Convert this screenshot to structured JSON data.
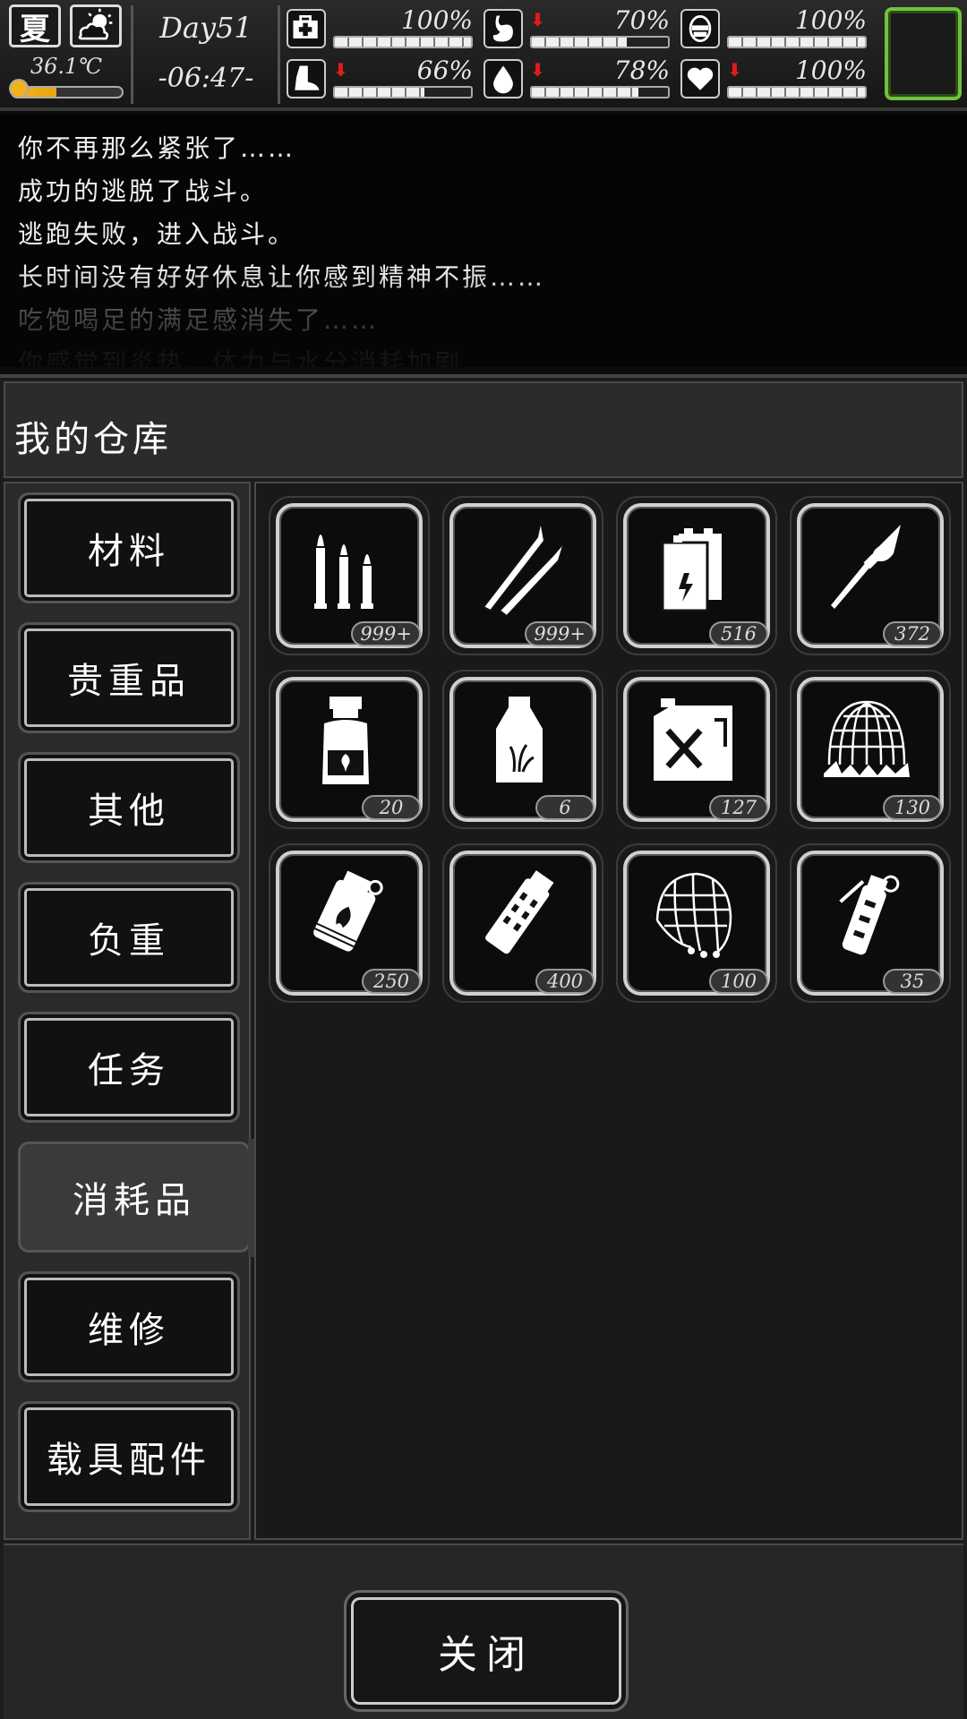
{
  "hud": {
    "season": "夏",
    "weather_icon": "sun-cloud-icon",
    "temperature": "36.1℃",
    "temperature_level": 0.4,
    "day": "Day51",
    "time": "-06:47-",
    "stats": [
      {
        "id": "health",
        "icon": "medkit-icon",
        "value": "100%",
        "level": 1.0,
        "arrow": ""
      },
      {
        "id": "hunger",
        "icon": "stomach-icon",
        "value": "70%",
        "level": 0.7,
        "arrow": "down"
      },
      {
        "id": "armor",
        "icon": "shield-icon",
        "value": "100%",
        "level": 1.0,
        "arrow": ""
      },
      {
        "id": "stamina",
        "icon": "boot-icon",
        "value": "66%",
        "level": 0.66,
        "arrow": "down"
      },
      {
        "id": "thirst",
        "icon": "water-drop-icon",
        "value": "78%",
        "level": 0.78,
        "arrow": "down"
      },
      {
        "id": "mood",
        "icon": "heart-icon",
        "value": "100%",
        "level": 1.0,
        "arrow": "down"
      }
    ],
    "down_arrow": "⬇"
  },
  "log": {
    "lines": [
      "你不再那么紧张了……",
      "成功的逃脱了战斗。",
      "逃跑失败，进入战斗。",
      "长时间没有好好休息让你感到精神不振……",
      "吃饱喝足的满足感消失了……",
      "你感觉到炎热，体力与水分消耗加剧"
    ]
  },
  "warehouse": {
    "title": "我的仓库",
    "tabs": [
      {
        "label": "材料",
        "active": false
      },
      {
        "label": "贵重品",
        "active": false
      },
      {
        "label": "其他",
        "active": false
      },
      {
        "label": "负重",
        "active": false
      },
      {
        "label": "任务",
        "active": false
      },
      {
        "label": "消耗品",
        "active": true
      },
      {
        "label": "维修",
        "active": false
      },
      {
        "label": "载具配件",
        "active": false
      }
    ],
    "items": [
      {
        "icon": "pistol-ammo-icon",
        "count": "999+"
      },
      {
        "icon": "rifle-ammo-icon",
        "count": "999+"
      },
      {
        "icon": "battery-icon",
        "count": "516"
      },
      {
        "icon": "rocket-icon",
        "count": "372"
      },
      {
        "icon": "medicine-bottle-icon",
        "count": "20"
      },
      {
        "icon": "water-bottle-icon",
        "count": "6"
      },
      {
        "icon": "fuel-can-icon",
        "count": "127"
      },
      {
        "icon": "net-trap-icon",
        "count": "130"
      },
      {
        "icon": "incendiary-bomb-icon",
        "count": "250"
      },
      {
        "icon": "flashbang-icon",
        "count": "400"
      },
      {
        "icon": "net-icon",
        "count": "100"
      },
      {
        "icon": "grenade-icon",
        "count": "35"
      }
    ],
    "close_label": "关闭"
  }
}
